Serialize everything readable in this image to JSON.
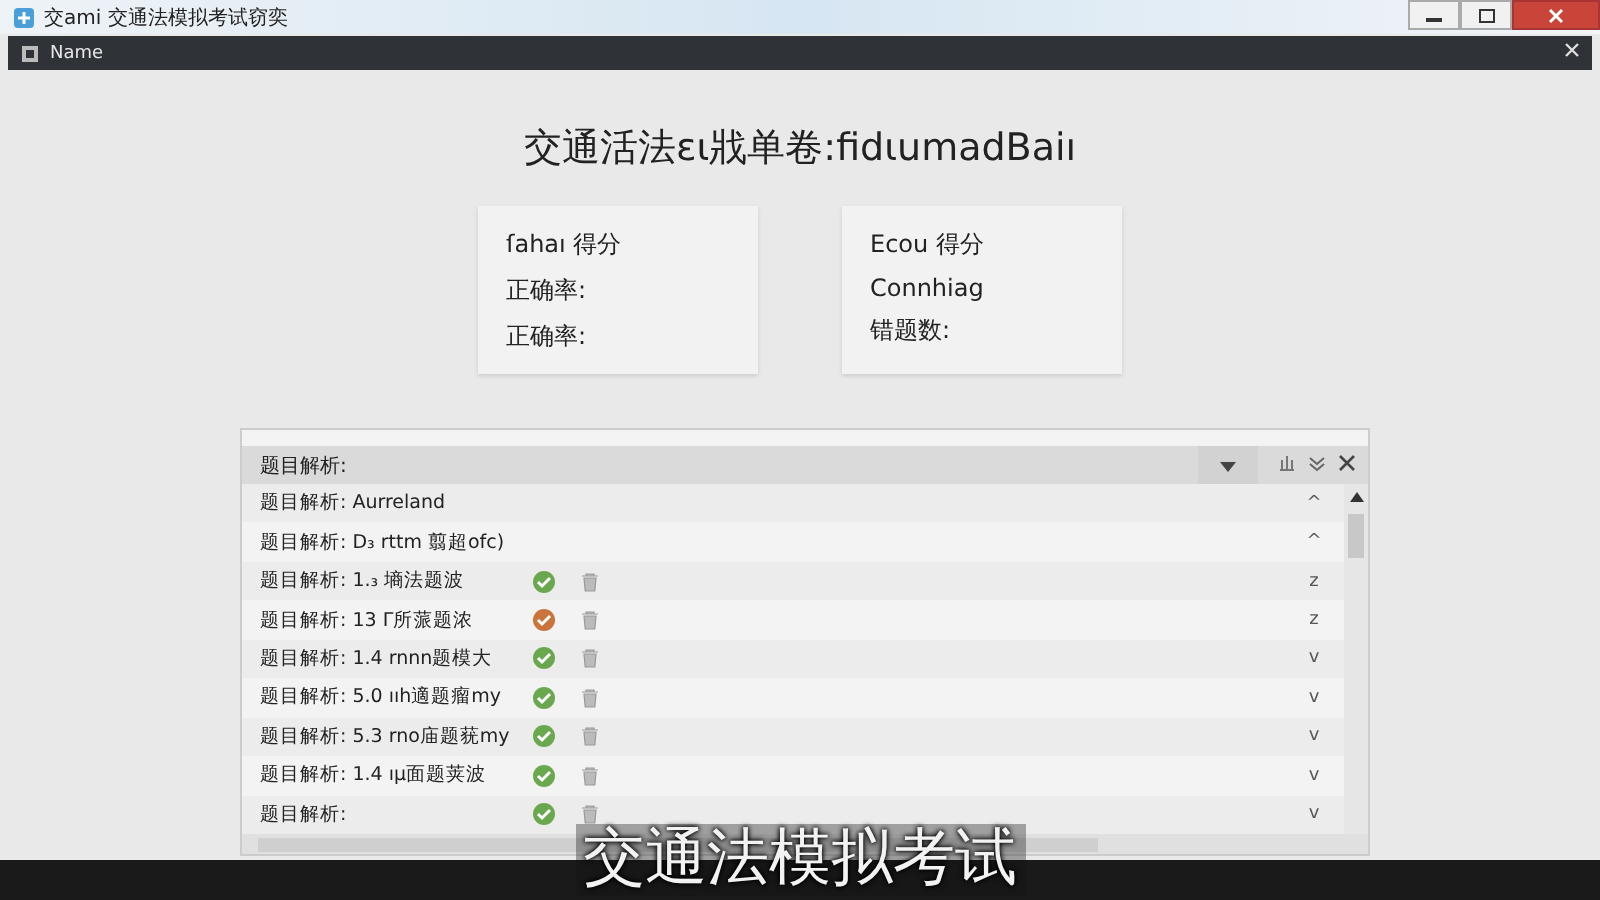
{
  "window": {
    "title": "交ami 交通法模拟考试窃奕"
  },
  "tab": {
    "title": "Name"
  },
  "heading": "交通活法ει戕单卷:fidιumadBaiı",
  "cards": [
    {
      "title": "ſahaı 得分",
      "lines": [
        "正确率:",
        "正确率:"
      ]
    },
    {
      "title": "Ecou 得分",
      "lines": [
        "Connhiag",
        "错题数:"
      ]
    }
  ],
  "panel": {
    "header": "题目解析:",
    "rows": [
      {
        "text": "题目解析: Aurreland",
        "marker": "^",
        "kind": "plain"
      },
      {
        "text": "题目解析: D₃ rttm 翦超ofc)",
        "marker": "^",
        "kind": "plain"
      },
      {
        "text": "题目解析: 1.₃ 墒法题波",
        "marker": "z",
        "kind": "result",
        "correct": true
      },
      {
        "text": "题目解析: 13 Γ所蒎题浓",
        "marker": "z",
        "kind": "result",
        "correct": false
      },
      {
        "text": "题目解析: 1.4 rnnn题模大",
        "marker": "v",
        "kind": "result",
        "correct": true
      },
      {
        "text": "题目解析: 5.0 ııh適题瘤my",
        "marker": "v",
        "kind": "result",
        "correct": true
      },
      {
        "text": "题目解析: 5.3 rno庙题莸my",
        "marker": "v",
        "kind": "result",
        "correct": true
      },
      {
        "text": "题目解析: 1.4 ıμ面题荚波",
        "marker": "v",
        "kind": "result",
        "correct": true
      },
      {
        "text": "题目解析:",
        "marker": "v",
        "kind": "result",
        "correct": true
      }
    ]
  },
  "caption": "交通法模拟考试"
}
